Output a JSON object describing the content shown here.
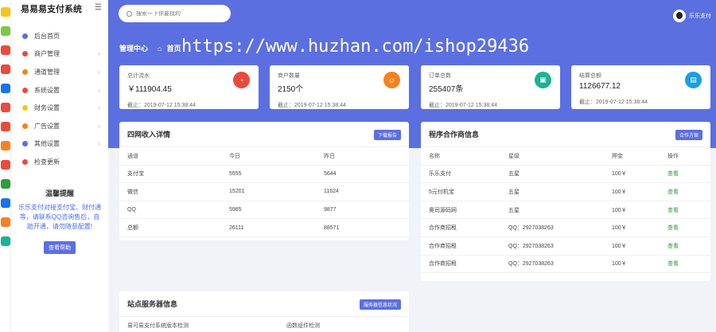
{
  "app": {
    "title": "易易易支付系统"
  },
  "strip_colors": [
    "#f5c518",
    "#7ac943",
    "#e94b3c",
    "#e94b3c",
    "#1a73e8",
    "#e94b3c",
    "#e94b3c",
    "#f58220",
    "#e94b3c",
    "#2e9e3a",
    "#1a73e8",
    "#f58220",
    "#1ab394"
  ],
  "sidebar": {
    "items": [
      {
        "label": "后台首页",
        "icon": "dashboard-icon",
        "color": "#5b6fe0",
        "chevron": false
      },
      {
        "label": "商户管理",
        "icon": "user-icon",
        "color": "#e94b3c",
        "chevron": true
      },
      {
        "label": "通道管理",
        "icon": "channel-icon",
        "color": "#f58220",
        "chevron": true
      },
      {
        "label": "系统设置",
        "icon": "gear-icon",
        "color": "#e94b3c",
        "chevron": true
      },
      {
        "label": "财务设置",
        "icon": "finance-icon",
        "color": "#f5c518",
        "chevron": true
      },
      {
        "label": "广告设置",
        "icon": "ad-icon",
        "color": "#f58220",
        "chevron": true
      },
      {
        "label": "其他设置",
        "icon": "other-icon",
        "color": "#5b6fe0",
        "chevron": true
      },
      {
        "label": "检查更新",
        "icon": "update-icon",
        "color": "#e94b3c",
        "chevron": false
      }
    ],
    "notice": {
      "title": "温馨提醒",
      "text": "乐乐支付对接支付宝、财付通等，请联系QQ咨询售后，自助开通，请勿随意配置!",
      "button": "查看帮助"
    }
  },
  "header": {
    "search_placeholder": "搜索一下你要找的",
    "user": "乐乐支付",
    "breadcrumb_title": "管理中心",
    "breadcrumb_home": "首页",
    "watermark": "https://www.huzhan.com/ishop29436"
  },
  "stats": [
    {
      "label": "总计流水",
      "value": "￥111904.45",
      "time": "截止：2019-07-12 15:38:44",
      "color": "#e94b3c",
      "icon": "pie-icon"
    },
    {
      "label": "商户数量",
      "value": "2150个",
      "time": "截止：2019-07-12 15:38:44",
      "color": "#f58220",
      "icon": "person-icon"
    },
    {
      "label": "订单总数",
      "value": "255407条",
      "time": "截止：2019-07-12 15:38:44",
      "color": "#1ab394",
      "icon": "cart-icon"
    },
    {
      "label": "结算总额",
      "value": "1126677.12",
      "time": "截止：2019-07-12 15:38:44",
      "color": "#1a9ee0",
      "icon": "card-icon"
    }
  ],
  "income": {
    "title": "四网收入详情",
    "button": "下载报告",
    "headers": [
      "通道",
      "今日",
      "昨日"
    ],
    "rows": [
      [
        "支付宝",
        "5555",
        "5644"
      ],
      [
        "微信",
        "15201",
        "11624"
      ],
      [
        "QQ",
        "5985",
        "9877"
      ],
      [
        "总额",
        "26111",
        "88571"
      ]
    ]
  },
  "partners": {
    "title": "程序合作商信息",
    "button": "合作方案",
    "headers": [
      "名称",
      "星级",
      "押金",
      "操作"
    ],
    "rows": [
      [
        "乐乐支付",
        "五星",
        "100￥",
        "查看"
      ],
      [
        "5元付机宝",
        "五星",
        "100￥",
        "查看"
      ],
      [
        "奥司源码网",
        "五星",
        "100￥",
        "查看"
      ],
      [
        "合作商招租",
        "QQ：2927038263",
        "100￥",
        "查看"
      ],
      [
        "合作商招租",
        "QQ：2927038263",
        "100￥",
        "查看"
      ],
      [
        "合作商招租",
        "QQ：2927038263",
        "100￥",
        "查看"
      ]
    ]
  },
  "server": {
    "title": "站点服务器信息",
    "button": "服务器信息状况",
    "headers": [
      "易可易支付系统版本检测",
      "函数组件检测"
    ]
  }
}
